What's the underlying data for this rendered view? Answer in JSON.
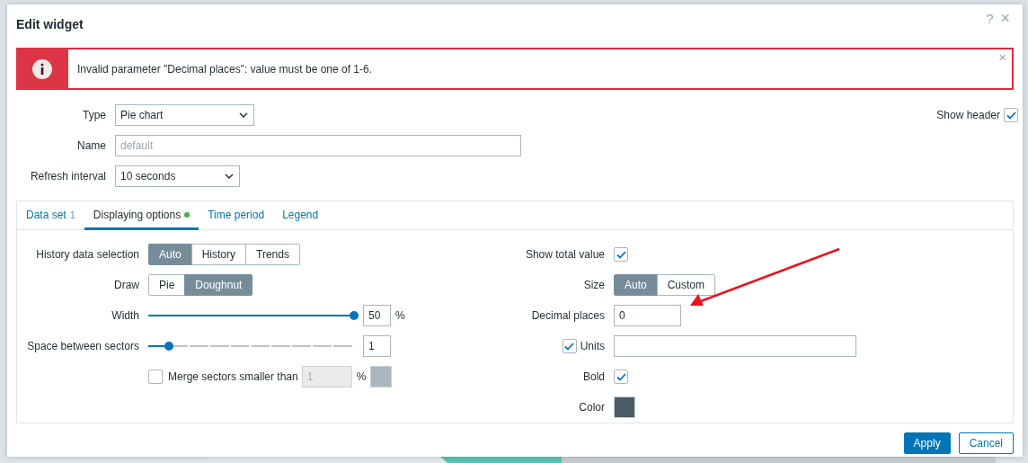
{
  "dialog": {
    "title": "Edit widget",
    "help": "?",
    "close": "×"
  },
  "error": {
    "message": "Invalid parameter \"Decimal places\": value must be one of 1-6.",
    "close": "×"
  },
  "fields": [
    {
      "label": "Type",
      "kind": "select",
      "value": "Pie chart"
    },
    {
      "label": "Name",
      "kind": "text",
      "placeholder": "default"
    },
    {
      "label": "Refresh interval",
      "kind": "select",
      "value": "10 seconds"
    }
  ],
  "show_header": {
    "label": "Show header",
    "checked": true
  },
  "tabs": [
    {
      "label": "Data set",
      "badge": "1",
      "modified": false,
      "selected": false
    },
    {
      "label": "Displaying options",
      "modified": true,
      "selected": true
    },
    {
      "label": "Time period",
      "modified": false,
      "selected": false
    },
    {
      "label": "Legend",
      "modified": false,
      "selected": false
    }
  ],
  "left": [
    {
      "kind": "segmented",
      "label": "History data selection",
      "options": [
        {
          "label": "Auto",
          "selected": true
        },
        {
          "label": "History",
          "selected": false
        },
        {
          "label": "Trends",
          "selected": false
        }
      ]
    },
    {
      "kind": "segmented",
      "label": "Draw",
      "options": [
        {
          "label": "Pie",
          "selected": false
        },
        {
          "label": "Doughnut",
          "selected": true
        }
      ]
    },
    {
      "kind": "slider",
      "label": "Width",
      "level": 1.0,
      "value": "50",
      "unit": "%"
    },
    {
      "kind": "slider",
      "label": "Space between sectors",
      "level": 0.1,
      "value": "1"
    },
    {
      "kind": "merge",
      "label": "Merge sectors smaller than",
      "checked": false,
      "disabled": true,
      "value": "1",
      "unit": "%"
    }
  ],
  "right": [
    {
      "kind": "checkbox",
      "label": "Show total value",
      "checked": true
    },
    {
      "kind": "segmented",
      "label": "Size",
      "options": [
        {
          "label": "Auto",
          "selected": true
        },
        {
          "label": "Custom",
          "selected": false
        }
      ]
    },
    {
      "kind": "text",
      "label": "Decimal places",
      "value": "0"
    },
    {
      "kind": "checked-field",
      "label": "Units",
      "checked": true
    },
    {
      "kind": "checkbox",
      "label": "Bold",
      "checked": true
    },
    {
      "kind": "color",
      "label": "Color",
      "color": "#4b5b66"
    }
  ],
  "buttons": [
    {
      "label": "Apply",
      "kind": "primary"
    },
    {
      "label": "Cancel",
      "kind": "secondary"
    }
  ]
}
